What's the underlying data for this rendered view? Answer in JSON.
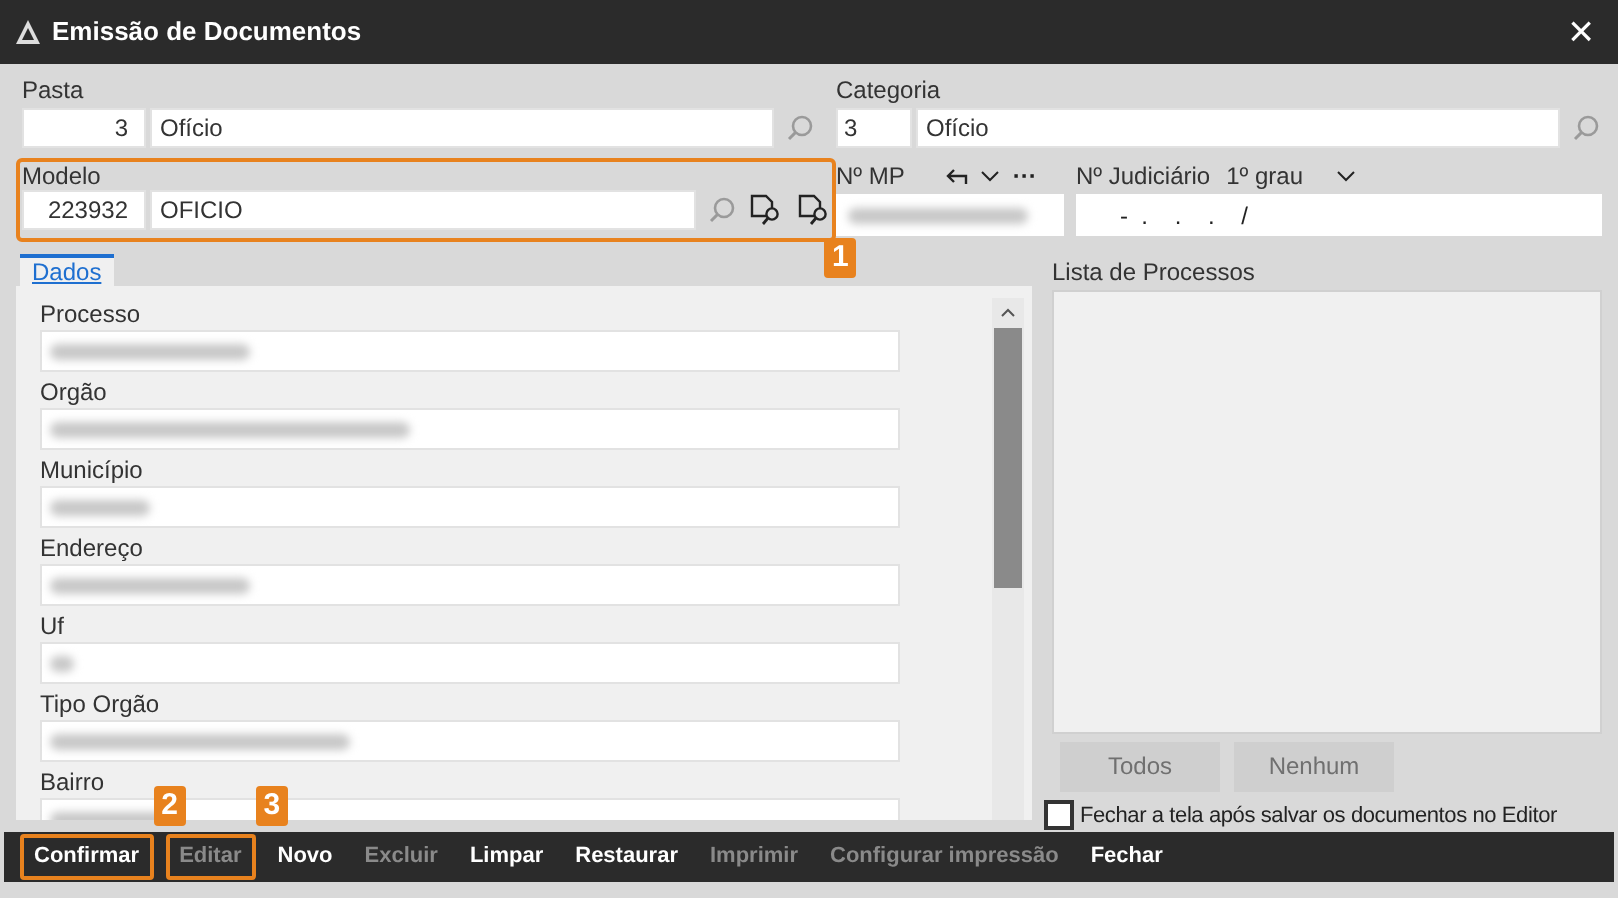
{
  "window": {
    "title": "Emissão de Documentos",
    "close_icon": "×"
  },
  "pasta": {
    "label": "Pasta",
    "code": "3",
    "name": "Ofício"
  },
  "categoria": {
    "label": "Categoria",
    "code": "3",
    "name": "Ofício"
  },
  "modelo": {
    "label": "Modelo",
    "code": "223932",
    "name": "OFICIO",
    "callout": "1"
  },
  "numero_mp": {
    "label": "Nº MP",
    "actions": "···"
  },
  "numero_judiciario": {
    "label": "Nº Judiciário",
    "grau": "1º grau",
    "value": "-  .    .    .    /"
  },
  "tabs": [
    {
      "label": "Dados",
      "selected": true
    }
  ],
  "fields": [
    {
      "label": "Processo"
    },
    {
      "label": "Orgão"
    },
    {
      "label": "Município"
    },
    {
      "label": "Endereço"
    },
    {
      "label": "Uf"
    },
    {
      "label": "Tipo Orgão"
    },
    {
      "label": "Bairro"
    }
  ],
  "processos": {
    "label": "Lista de Processos",
    "buttons": [
      {
        "label": "Todos",
        "disabled": true
      },
      {
        "label": "Nenhum",
        "disabled": true
      }
    ],
    "close_option": {
      "label": "Fechar a tela após salvar os documentos no Editor",
      "checked": false
    }
  },
  "toolbar": [
    {
      "label": "Confirmar",
      "disabled": false,
      "callout": "2"
    },
    {
      "label": "Editar",
      "disabled": true,
      "callout": "3"
    },
    {
      "label": "Novo",
      "disabled": false
    },
    {
      "label": "Excluir",
      "disabled": true
    },
    {
      "label": "Limpar",
      "disabled": false
    },
    {
      "label": "Restaurar",
      "disabled": false
    },
    {
      "label": "Imprimir",
      "disabled": true
    },
    {
      "label": "Configurar impressão",
      "disabled": true
    },
    {
      "label": "Fechar",
      "disabled": false
    }
  ]
}
